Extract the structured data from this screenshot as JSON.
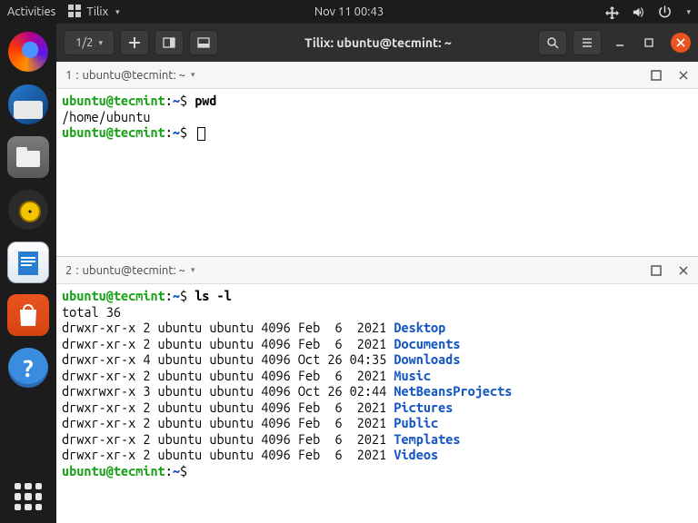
{
  "topbar": {
    "activities": "Activities",
    "app_name": "Tilix",
    "clock": "Nov 11  00:43"
  },
  "dock": {
    "items": [
      "firefox",
      "thunderbird",
      "files",
      "music",
      "writer",
      "software",
      "help"
    ]
  },
  "titlebar": {
    "session": "1/2",
    "title": "Tilix: ubuntu@tecmint: ~"
  },
  "panes": [
    {
      "index": "1",
      "label": "ubuntu@tecmint: ~",
      "prompt_user": "ubuntu@tecmint",
      "prompt_path": "~",
      "lines": [
        {
          "type": "cmd",
          "text": "pwd"
        },
        {
          "type": "out",
          "text": "/home/ubuntu"
        },
        {
          "type": "cmd",
          "text": "",
          "cursor": true
        }
      ]
    },
    {
      "index": "2",
      "label": "ubuntu@tecmint: ~",
      "prompt_user": "ubuntu@tecmint",
      "prompt_path": "~",
      "cmd": "ls -l",
      "total": "total 36",
      "rows": [
        {
          "perm": "drwxr-xr-x",
          "n": "2",
          "o": "ubuntu",
          "g": "ubuntu",
          "s": "4096",
          "d": "Feb  6  2021",
          "name": "Desktop"
        },
        {
          "perm": "drwxr-xr-x",
          "n": "2",
          "o": "ubuntu",
          "g": "ubuntu",
          "s": "4096",
          "d": "Feb  6  2021",
          "name": "Documents"
        },
        {
          "perm": "drwxr-xr-x",
          "n": "4",
          "o": "ubuntu",
          "g": "ubuntu",
          "s": "4096",
          "d": "Oct 26 04:35",
          "name": "Downloads"
        },
        {
          "perm": "drwxr-xr-x",
          "n": "2",
          "o": "ubuntu",
          "g": "ubuntu",
          "s": "4096",
          "d": "Feb  6  2021",
          "name": "Music"
        },
        {
          "perm": "drwxrwxr-x",
          "n": "3",
          "o": "ubuntu",
          "g": "ubuntu",
          "s": "4096",
          "d": "Oct 26 02:44",
          "name": "NetBeansProjects"
        },
        {
          "perm": "drwxr-xr-x",
          "n": "2",
          "o": "ubuntu",
          "g": "ubuntu",
          "s": "4096",
          "d": "Feb  6  2021",
          "name": "Pictures"
        },
        {
          "perm": "drwxr-xr-x",
          "n": "2",
          "o": "ubuntu",
          "g": "ubuntu",
          "s": "4096",
          "d": "Feb  6  2021",
          "name": "Public"
        },
        {
          "perm": "drwxr-xr-x",
          "n": "2",
          "o": "ubuntu",
          "g": "ubuntu",
          "s": "4096",
          "d": "Feb  6  2021",
          "name": "Templates"
        },
        {
          "perm": "drwxr-xr-x",
          "n": "2",
          "o": "ubuntu",
          "g": "ubuntu",
          "s": "4096",
          "d": "Feb  6  2021",
          "name": "Videos"
        }
      ],
      "final_prompt": true
    }
  ]
}
